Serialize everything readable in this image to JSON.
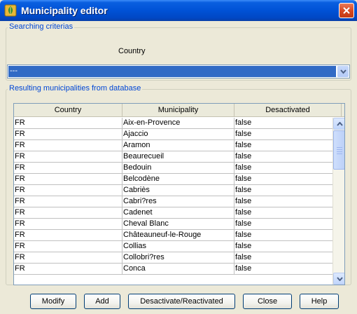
{
  "window": {
    "title": "Municipality editor"
  },
  "search": {
    "legend": "Searching criterias",
    "country_label": "Country",
    "country_selected": "---"
  },
  "results": {
    "legend": "Resulting municipalities from database",
    "columns": [
      "Country",
      "Municipality",
      "Desactivated"
    ],
    "rows": [
      [
        "FR",
        "Aix-en-Provence",
        "false"
      ],
      [
        "FR",
        "Ajaccio",
        "false"
      ],
      [
        "FR",
        "Aramon",
        "false"
      ],
      [
        "FR",
        "Beaurecueil",
        "false"
      ],
      [
        "FR",
        "Bedouin",
        "false"
      ],
      [
        "FR",
        "Belcodène",
        "false"
      ],
      [
        "FR",
        "Cabriès",
        "false"
      ],
      [
        "FR",
        "Cabri?res",
        "false"
      ],
      [
        "FR",
        "Cadenet",
        "false"
      ],
      [
        "FR",
        "Cheval Blanc",
        "false"
      ],
      [
        "FR",
        "Châteauneuf-le-Rouge",
        "false"
      ],
      [
        "FR",
        "Collias",
        "false"
      ],
      [
        "FR",
        "Collobri?res",
        "false"
      ],
      [
        "FR",
        "Conca",
        "false"
      ]
    ]
  },
  "buttons": {
    "modify": "Modify",
    "add": "Add",
    "toggle": "Desactivate/Reactivated",
    "close": "Close",
    "help": "Help"
  },
  "icons": {
    "app": "leaf-shield-icon",
    "close": "close-icon",
    "combo_arrow": "chevron-down-icon",
    "scroll_up": "arrow-up-icon",
    "scroll_down": "arrow-down-icon"
  },
  "colors": {
    "title_bar": "#0052d6",
    "legend_text": "#0046d5",
    "selection": "#316ac5",
    "close_button": "#d6461f"
  }
}
